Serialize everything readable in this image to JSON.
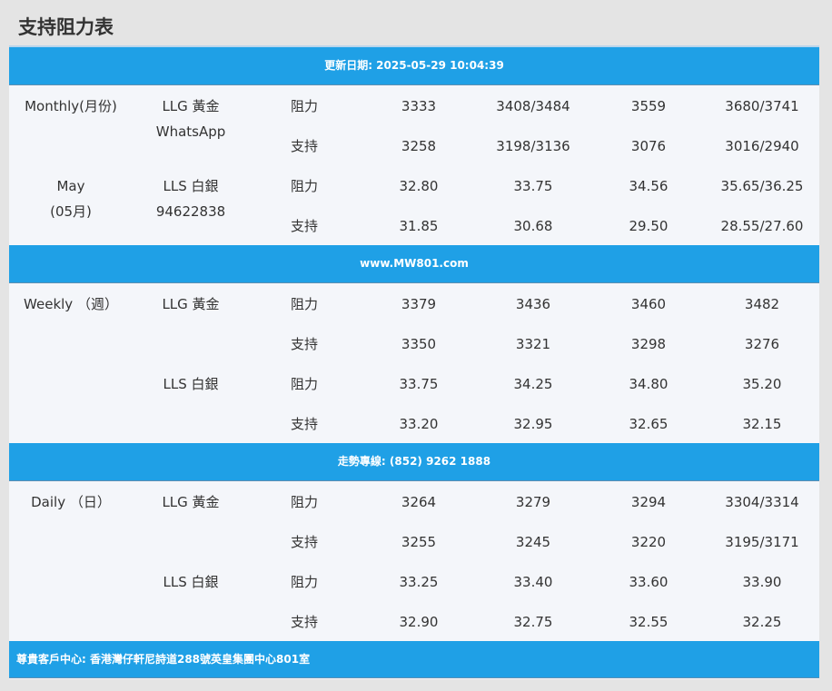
{
  "page_title": "支持阻力表",
  "banners": {
    "update": "更新日期: 2025-05-29 10:04:39",
    "site": "www.MW801.com",
    "hotline": "走勢專線: (852) 9262 1888",
    "address": "尊貴客戶中心: 香港灣仔軒尼詩道288號英皇集團中心801室"
  },
  "monthly": {
    "period": "Monthly(月份)",
    "month": "May",
    "month_num": "(05月)",
    "contact_label": "WhatsApp",
    "contact_number": "94622838",
    "gold": {
      "name": "LLG 黃金",
      "resist_label": "阻力",
      "resist": [
        "3333",
        "3408/3484",
        "3559",
        "3680/3741"
      ],
      "support_label": "支持",
      "support": [
        "3258",
        "3198/3136",
        "3076",
        "3016/2940"
      ]
    },
    "silver": {
      "name": "LLS 白銀",
      "resist_label": "阻力",
      "resist": [
        "32.80",
        "33.75",
        "34.56",
        "35.65/36.25"
      ],
      "support_label": "支持",
      "support": [
        "31.85",
        "30.68",
        "29.50",
        "28.55/27.60"
      ]
    }
  },
  "weekly": {
    "period": "Weekly （週）",
    "gold": {
      "name": "LLG 黃金",
      "resist_label": "阻力",
      "resist": [
        "3379",
        "3436",
        "3460",
        "3482"
      ],
      "support_label": "支持",
      "support": [
        "3350",
        "3321",
        "3298",
        "3276"
      ]
    },
    "silver": {
      "name": "LLS 白銀",
      "resist_label": "阻力",
      "resist": [
        "33.75",
        "34.25",
        "34.80",
        "35.20"
      ],
      "support_label": "支持",
      "support": [
        "33.20",
        "32.95",
        "32.65",
        "32.15"
      ]
    }
  },
  "daily": {
    "period": "Daily （日）",
    "gold": {
      "name": "LLG 黃金",
      "resist_label": "阻力",
      "resist": [
        "3264",
        "3279",
        "3294",
        "3304/3314"
      ],
      "support_label": "支持",
      "support": [
        "3255",
        "3245",
        "3220",
        "3195/3171"
      ]
    },
    "silver": {
      "name": "LLS 白銀",
      "resist_label": "阻力",
      "resist": [
        "33.25",
        "33.40",
        "33.60",
        "33.90"
      ],
      "support_label": "支持",
      "support": [
        "32.90",
        "32.75",
        "32.55",
        "32.25"
      ]
    }
  }
}
